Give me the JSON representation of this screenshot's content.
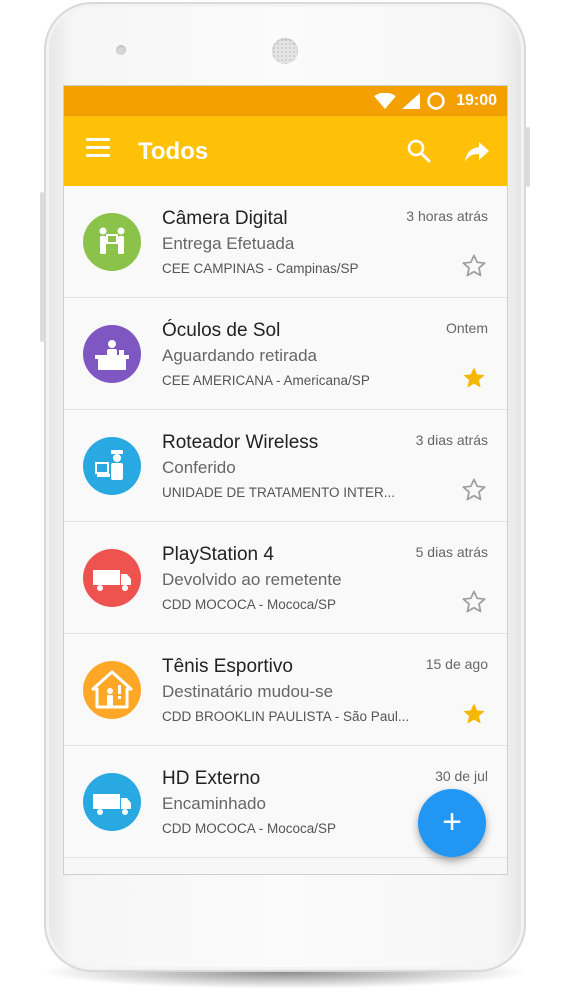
{
  "status_bar": {
    "time": "19:00"
  },
  "app_bar": {
    "title": "Todos"
  },
  "items": [
    {
      "title": "Câmera Digital",
      "status": "Entrega Efetuada",
      "place": "CEE CAMPINAS - Campinas/SP",
      "date": "3 horas atrás",
      "starred": false,
      "avatar_color": "#8bc34a",
      "icon": "delivery-handover-icon"
    },
    {
      "title": "Óculos de Sol",
      "status": "Aguardando retirada",
      "place": "CEE AMERICANA - Americana/SP",
      "date": "Ontem",
      "starred": true,
      "avatar_color": "#7e57c2",
      "icon": "service-counter-icon"
    },
    {
      "title": "Roteador Wireless",
      "status": "Conferido",
      "place": "UNIDADE DE TRATAMENTO INTER...",
      "date": "3 dias atrás",
      "starred": false,
      "avatar_color": "#29a9e1",
      "icon": "inspector-icon"
    },
    {
      "title": "PlayStation 4",
      "status": "Devolvido ao remetente",
      "place": "CDD MOCOCA - Mococa/SP",
      "date": "5 dias atrás",
      "starred": false,
      "avatar_color": "#ef5350",
      "icon": "truck-icon"
    },
    {
      "title": "Tênis Esportivo",
      "status": "Destinatário mudou-se",
      "place": "CDD BROOKLIN PAULISTA - São Paul...",
      "date": "15 de ago",
      "starred": true,
      "avatar_color": "#ffa726",
      "icon": "house-alert-icon"
    },
    {
      "title": "HD Externo",
      "status": "Encaminhado",
      "place": "CDD MOCOCA - Mococa/SP",
      "date": "30 de jul",
      "starred": false,
      "avatar_color": "#29a9e1",
      "icon": "truck-icon"
    }
  ],
  "fab": {
    "label": "+"
  },
  "colors": {
    "status_bar": "#f4a000",
    "app_bar": "#ffc107",
    "star_on": "#f5b800",
    "star_off": "#9e9e9e",
    "fab": "#2196f3"
  }
}
